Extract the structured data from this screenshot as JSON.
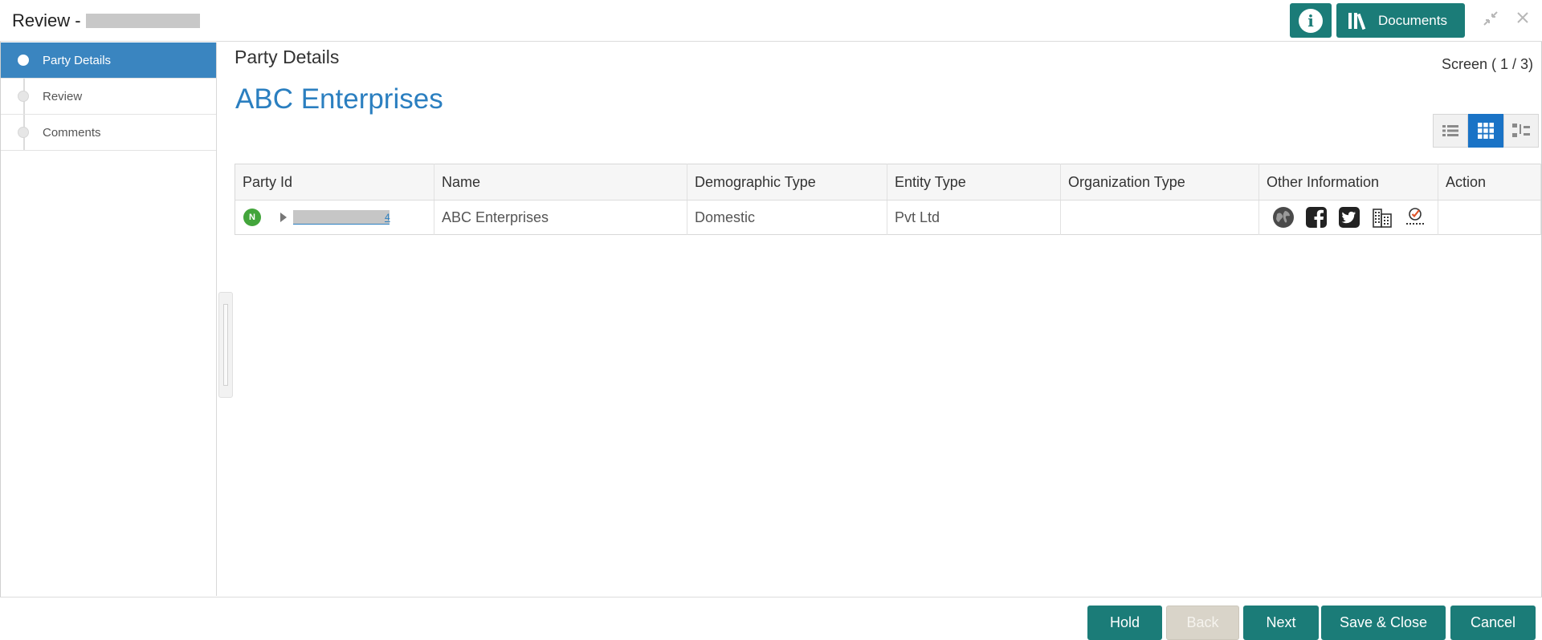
{
  "header": {
    "title": "Review -",
    "info_label": "i",
    "documents_label": "Documents"
  },
  "sidebar": {
    "steps": [
      {
        "label": "Party Details",
        "active": true
      },
      {
        "label": "Review",
        "active": false
      },
      {
        "label": "Comments",
        "active": false
      }
    ]
  },
  "main": {
    "title": "Party Details",
    "screen_indicator": "Screen ( 1 / 3)",
    "party_name": "ABC Enterprises"
  },
  "table": {
    "columns": [
      "Party Id",
      "Name",
      "Demographic Type",
      "Entity Type",
      "Organization Type",
      "Other Information",
      "Action"
    ],
    "rows": [
      {
        "badge": "N",
        "party_id_suffix": "4",
        "name": "ABC Enterprises",
        "demographic_type": "Domestic",
        "entity_type": "Pvt Ltd",
        "organization_type": "",
        "other_information_icons": [
          "globe-icon",
          "facebook-icon",
          "twitter-icon",
          "building-icon",
          "checklist-icon"
        ],
        "action": ""
      }
    ]
  },
  "footer": {
    "hold": "Hold",
    "back": "Back",
    "next": "Next",
    "save_close": "Save & Close",
    "cancel": "Cancel"
  },
  "colors": {
    "primary_teal": "#1b7c78",
    "active_step_blue": "#3a85c0",
    "link_blue": "#2b7fc0",
    "badge_green": "#43a53b"
  }
}
